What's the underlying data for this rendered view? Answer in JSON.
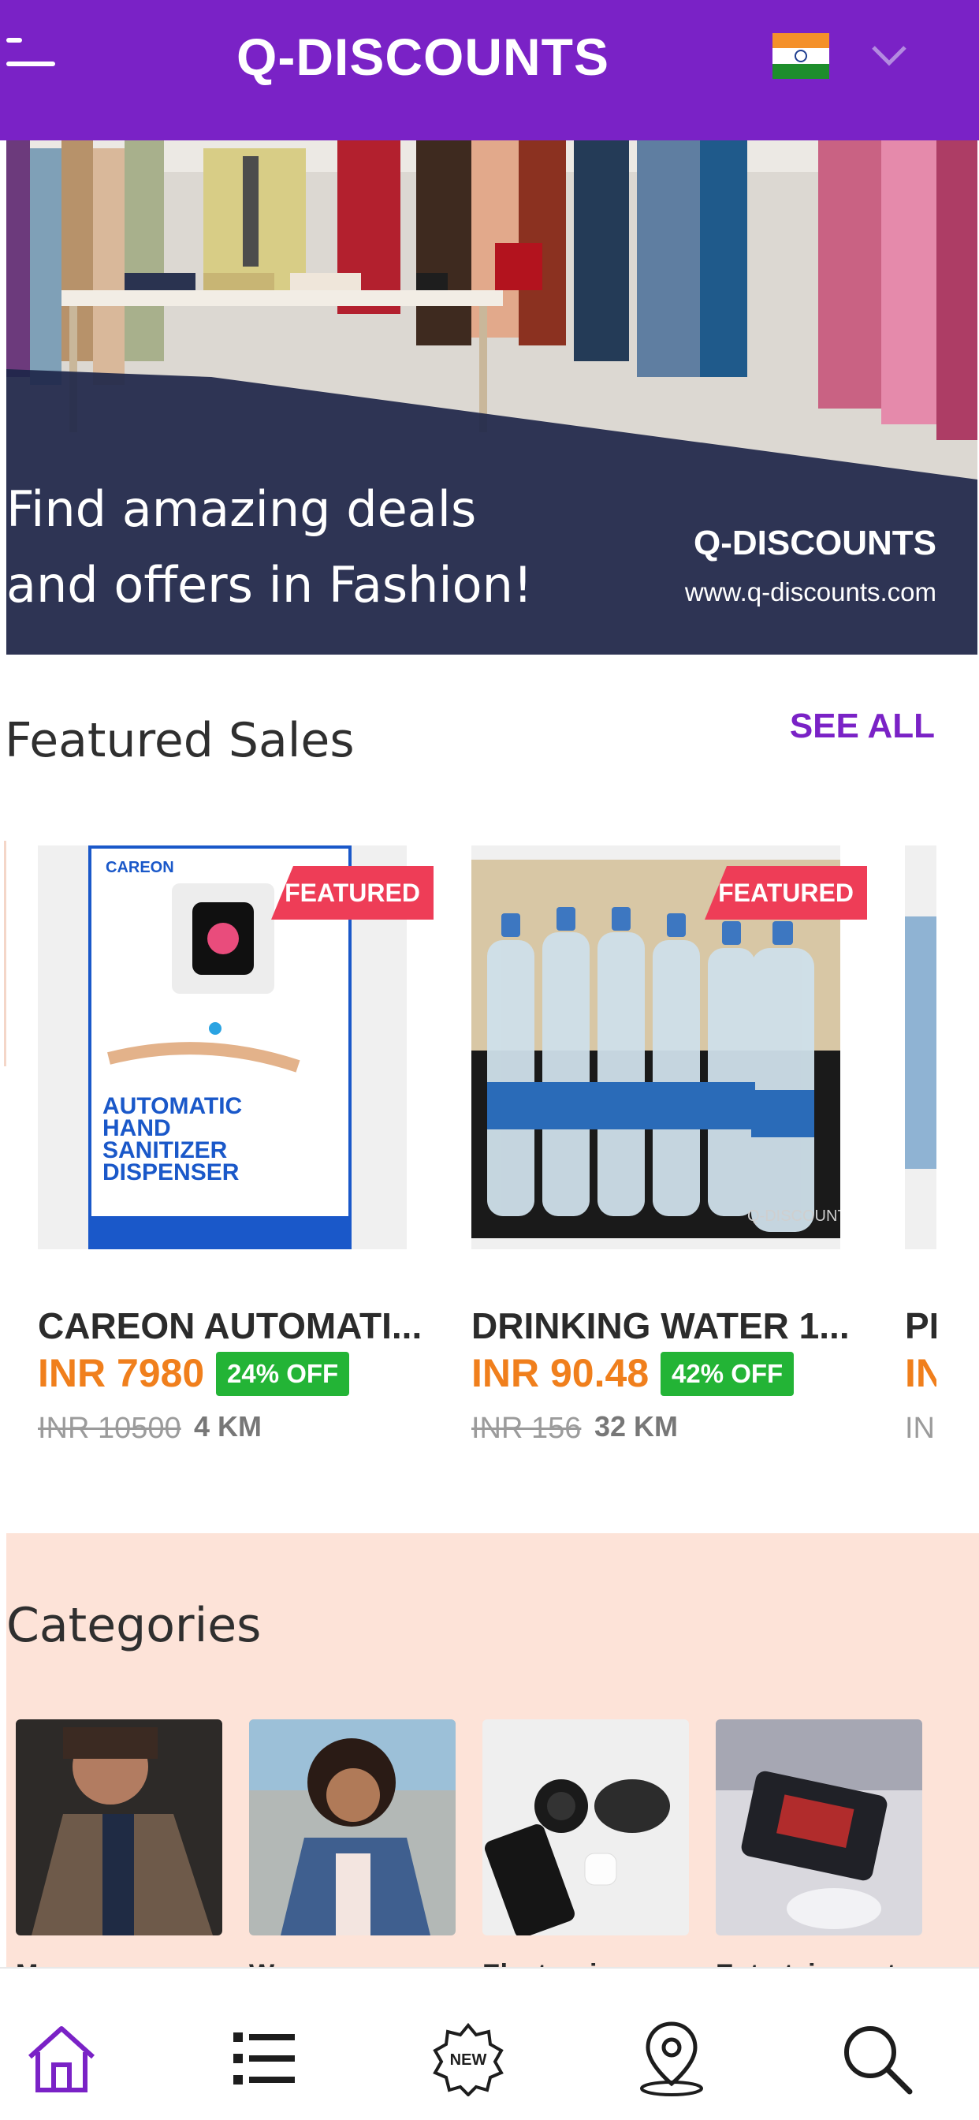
{
  "header": {
    "logo": "Q-DISCOUNTS",
    "menu_icon": "menu-icon",
    "flag_icon": "india-flag-icon",
    "dropdown_icon": "chevron-down-icon"
  },
  "banner": {
    "headline_line1": "Find amazing deals",
    "headline_line2": "and offers in Fashion!",
    "brand": "Q-DISCOUNTS",
    "url": "www.q-discounts.com"
  },
  "featured": {
    "title": "Featured Sales",
    "see_all": "SEE ALL",
    "badge": "FEATURED",
    "items": [
      {
        "title": "CAREON AUTOMATI...",
        "price": "INR 7980",
        "discount": "24% OFF",
        "old_price": "INR 10500",
        "distance": "4 KM",
        "image_text": {
          "brand": "CAREON",
          "lines": [
            "AUTOMATIC",
            "HAND",
            "SANITIZER",
            "DISPENSER"
          ]
        }
      },
      {
        "title": "DRINKING WATER 1...",
        "price": "INR 90.48",
        "discount": "42% OFF",
        "old_price": "INR 156",
        "distance": "32 KM",
        "image_text": {
          "watermark": "Q-DISCOUNTS"
        }
      },
      {
        "title": "PI",
        "price": "IN",
        "old_price": "IN"
      }
    ]
  },
  "categories": {
    "title": "Categories",
    "items": [
      "Men",
      "Women",
      "Electronics",
      "Entertainment"
    ]
  },
  "bottom_nav": {
    "items": [
      "home-icon",
      "list-icon",
      "new-badge-icon",
      "location-pin-icon",
      "search-icon"
    ],
    "new_label": "NEW",
    "active_color": "#7a22c6"
  }
}
